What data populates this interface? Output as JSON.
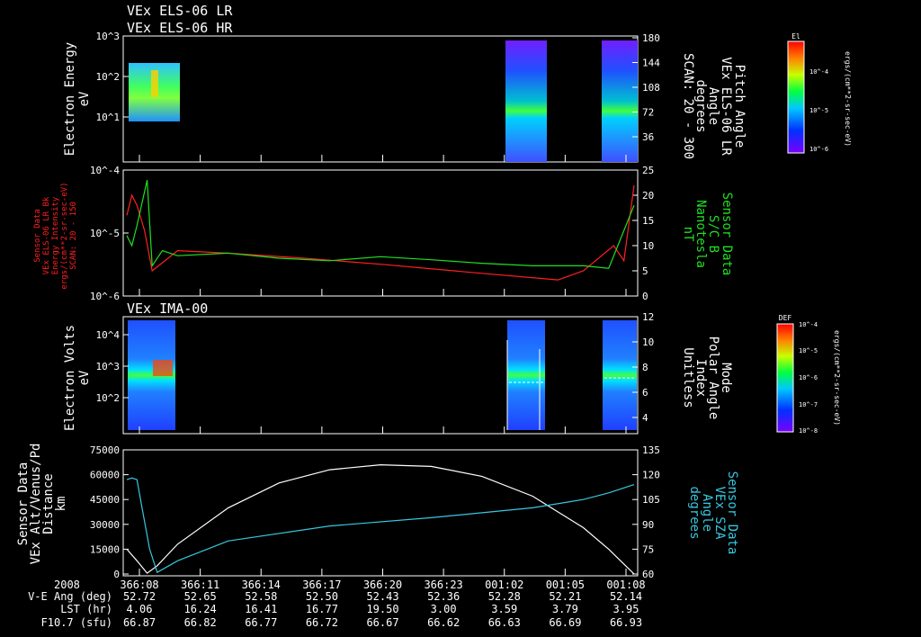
{
  "header": {
    "lr_title": "VEx ELS-06 LR",
    "hr_title": "VEx ELS-06 HR"
  },
  "colors": {
    "red": "#ff2020",
    "green": "#20e020",
    "cyan": "#38c8e0",
    "white": "#ffffff"
  },
  "chart_data": [
    {
      "type": "heatmap",
      "id": "panel1",
      "ylabel": [
        "Electron Energy",
        "eV"
      ],
      "yticks": [
        "10^3",
        "10^2",
        "10^1"
      ],
      "ylim_log": [
        0,
        3
      ],
      "right_axis_label": [
        "Pitch Angle",
        "VEx ELS-06 LR",
        "Angle",
        "degrees",
        "SCAN: 20 - 300"
      ],
      "right_ticks": [
        "180",
        "144",
        "108",
        "72",
        "36"
      ],
      "right_ylim": [
        0,
        180
      ],
      "colorbar": {
        "title": "El",
        "label": "ergs/(cm**2-sr-sec-eV)",
        "ticks": [
          "10^-4",
          "10^-5",
          "10^-6"
        ]
      }
    },
    {
      "type": "line",
      "id": "panel2",
      "ylabel_left": [
        "Sensor Data",
        "VEx ELS-06 LR Bk",
        "Energy Intensity",
        "ergs/(cm**2-sr-sec-eV)",
        "SCAN: 20 - 150"
      ],
      "yticks_left": [
        "10^-4",
        "10^-5",
        "10^-6"
      ],
      "ylabel_right": [
        "Sensor Data",
        "S/C B",
        "Nanotesla",
        "nT"
      ],
      "yticks_right": [
        "25",
        "20",
        "15",
        "10",
        "5",
        "0"
      ],
      "right_ylim": [
        0,
        25
      ],
      "series": [
        {
          "color": "red",
          "x": [
            0,
            0.01,
            0.02,
            0.035,
            0.05,
            0.1,
            0.2,
            0.35,
            0.5,
            0.7,
            0.85,
            0.9,
            0.96,
            0.98,
            1.0
          ],
          "y": [
            16,
            20,
            18,
            13,
            5,
            9,
            8.5,
            7.5,
            6.3,
            4.5,
            3.2,
            5,
            10,
            7,
            22
          ]
        },
        {
          "color": "green",
          "x": [
            0,
            0.01,
            0.02,
            0.04,
            0.05,
            0.07,
            0.1,
            0.2,
            0.3,
            0.4,
            0.5,
            0.6,
            0.7,
            0.8,
            0.9,
            0.95,
            1.0
          ],
          "y": [
            12,
            10,
            14,
            23,
            6,
            9,
            8,
            8.5,
            7.5,
            7,
            7.8,
            7.2,
            6.5,
            6,
            6,
            5.5,
            18
          ]
        }
      ]
    },
    {
      "type": "heatmap",
      "id": "panel3",
      "title": "VEx IMA-00",
      "ylabel": [
        "Electron Volts",
        "eV"
      ],
      "yticks": [
        "10^4",
        "10^3",
        "10^2"
      ],
      "right_axis_label": [
        "Mode",
        "Polar Angle",
        "Index",
        "Unitless"
      ],
      "right_ticks": [
        "12",
        "10",
        "8",
        "6",
        "4"
      ],
      "right_ylim": [
        3,
        12
      ],
      "colorbar": {
        "title": "DEF",
        "label": "ergs/(cm**2-sr-sec-eV)",
        "ticks": [
          "10^-4",
          "10^-5",
          "10^-6",
          "10^-7",
          "10^-8"
        ]
      }
    },
    {
      "type": "line",
      "id": "panel4",
      "ylabel_left": [
        "Sensor Data",
        "VEx Alt/Venus/Pd",
        "Distance",
        "km"
      ],
      "yticks_left": [
        "75000",
        "60000",
        "45000",
        "30000",
        "15000",
        "0"
      ],
      "left_ylim": [
        0,
        75000
      ],
      "ylabel_right": [
        "Sensor Data",
        "VEx SZA",
        "Angle",
        "degrees"
      ],
      "yticks_right": [
        "135",
        "120",
        "105",
        "90",
        "75",
        "60"
      ],
      "right_ylim": [
        60,
        135
      ],
      "series": [
        {
          "color": "white",
          "axis": "left",
          "x": [
            0,
            0.02,
            0.04,
            0.06,
            0.1,
            0.2,
            0.3,
            0.4,
            0.5,
            0.6,
            0.7,
            0.8,
            0.9,
            0.95,
            1.0
          ],
          "y": [
            15000,
            8000,
            500,
            5000,
            18000,
            40000,
            55000,
            63000,
            66000,
            65000,
            59000,
            47000,
            28000,
            15000,
            0
          ]
        },
        {
          "color": "cyan",
          "axis": "right",
          "x": [
            0,
            0.01,
            0.02,
            0.03,
            0.045,
            0.06,
            0.1,
            0.2,
            0.4,
            0.6,
            0.8,
            0.9,
            0.95,
            1.0
          ],
          "y": [
            117,
            118,
            117,
            100,
            75,
            61,
            68,
            80,
            89,
            94,
            100,
            105,
            109,
            114
          ]
        }
      ]
    }
  ],
  "footer": {
    "year": "2008",
    "row_labels": [
      "V-E Ang (deg)",
      "LST (hr)",
      "F10.7 (sfu)"
    ],
    "columns": [
      {
        "time": "366:08",
        "vea": "52.72",
        "lst": "4.06",
        "f107": "66.87"
      },
      {
        "time": "366:11",
        "vea": "52.65",
        "lst": "16.24",
        "f107": "66.82"
      },
      {
        "time": "366:14",
        "vea": "52.58",
        "lst": "16.41",
        "f107": "66.77"
      },
      {
        "time": "366:17",
        "vea": "52.50",
        "lst": "16.77",
        "f107": "66.72"
      },
      {
        "time": "366:20",
        "vea": "52.43",
        "lst": "19.50",
        "f107": "66.67"
      },
      {
        "time": "366:23",
        "vea": "52.36",
        "lst": "3.00",
        "f107": "66.62"
      },
      {
        "time": "001:02",
        "vea": "52.28",
        "lst": "3.59",
        "f107": "66.63"
      },
      {
        "time": "001:05",
        "vea": "52.21",
        "lst": "3.79",
        "f107": "66.69"
      },
      {
        "time": "001:08",
        "vea": "52.14",
        "lst": "3.95",
        "f107": "66.93"
      }
    ]
  }
}
